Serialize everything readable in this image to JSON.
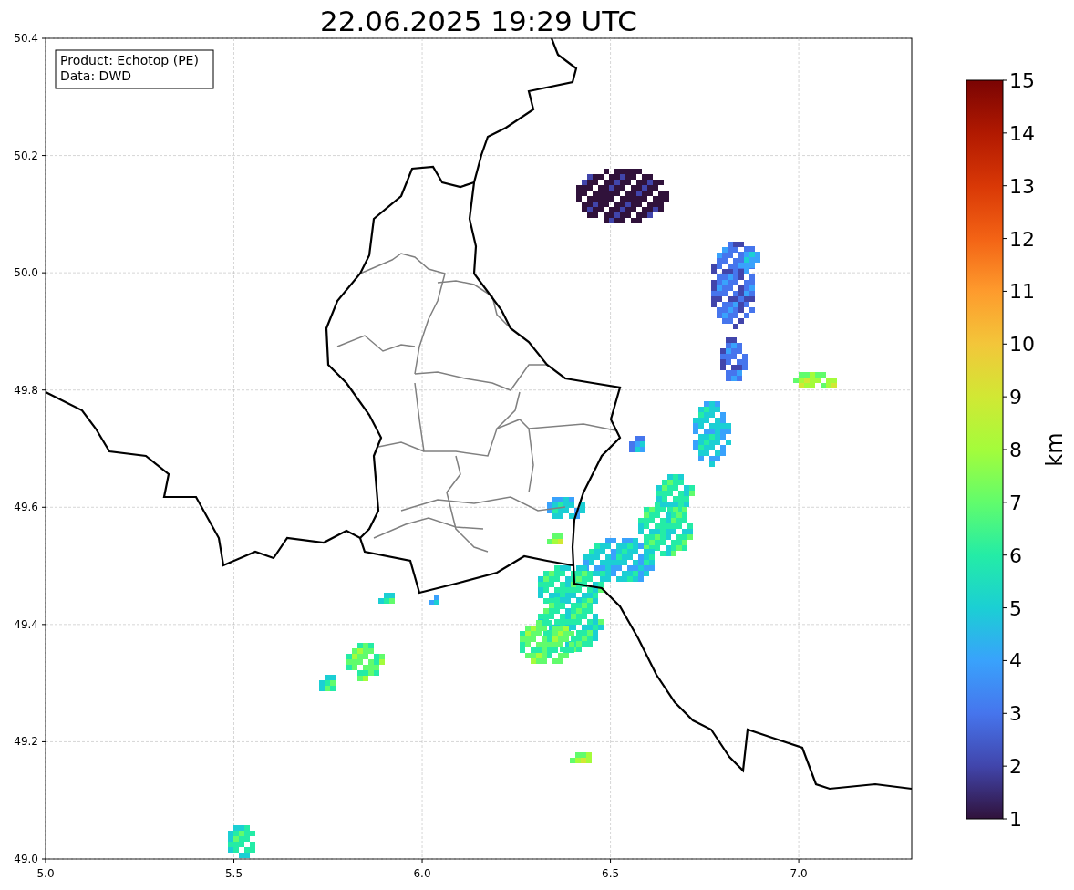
{
  "title": "22.06.2025 19:29 UTC",
  "info_box": {
    "lines": [
      "Product: Echotop (PE)",
      "Data: DWD"
    ]
  },
  "x_axis": {
    "tick_labels": [
      "5.0",
      "5.5",
      "6.0",
      "6.5",
      "7.0"
    ]
  },
  "y_axis": {
    "tick_labels": [
      "50.4",
      "50.2",
      "50.0",
      "49.8",
      "49.6",
      "49.4",
      "49.2",
      "49.0"
    ]
  },
  "colorbar": {
    "label": "km",
    "tick_labels": [
      "15",
      "14",
      "13",
      "12",
      "11",
      "10",
      "9",
      "8",
      "7",
      "6",
      "5",
      "4",
      "3",
      "2",
      "1"
    ]
  }
}
